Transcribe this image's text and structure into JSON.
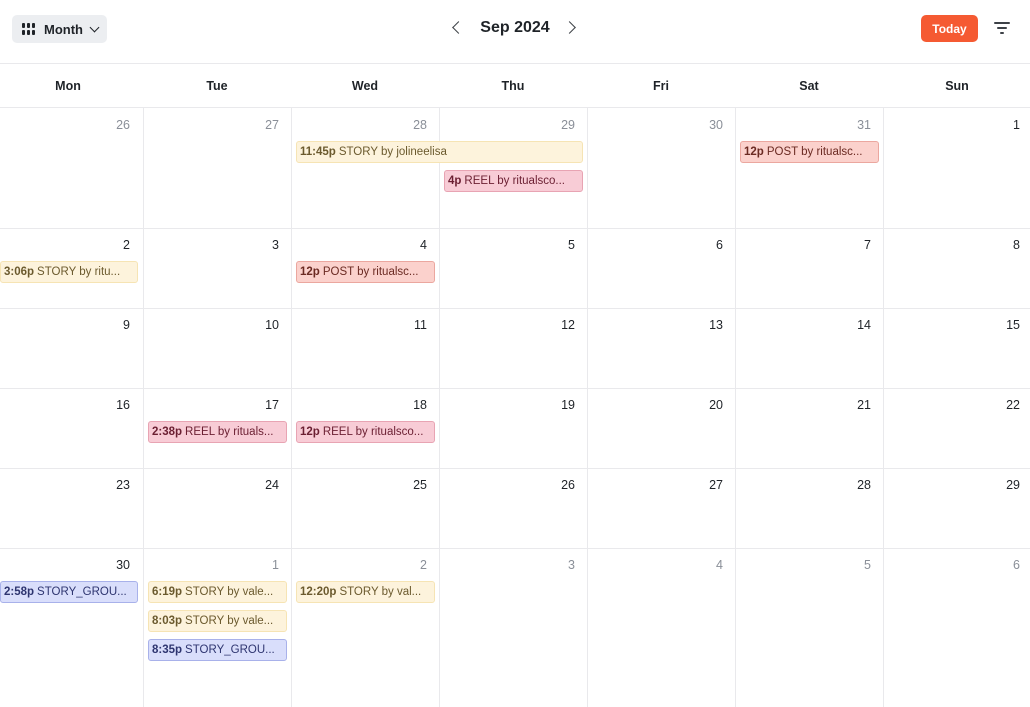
{
  "toolbar": {
    "view_label": "Month",
    "title": "Sep 2024",
    "today_label": "Today"
  },
  "weekdays": [
    "Mon",
    "Tue",
    "Wed",
    "Thu",
    "Fri",
    "Sat",
    "Sun"
  ],
  "weeks": [
    [
      {
        "n": "26",
        "out": true
      },
      {
        "n": "27",
        "out": true
      },
      {
        "n": "28",
        "out": true
      },
      {
        "n": "29",
        "out": true
      },
      {
        "n": "30",
        "out": true
      },
      {
        "n": "31",
        "out": true
      },
      {
        "n": "1",
        "out": false
      }
    ],
    [
      {
        "n": "2",
        "out": false
      },
      {
        "n": "3",
        "out": false
      },
      {
        "n": "4",
        "out": false
      },
      {
        "n": "5",
        "out": false
      },
      {
        "n": "6",
        "out": false
      },
      {
        "n": "7",
        "out": false
      },
      {
        "n": "8",
        "out": false
      }
    ],
    [
      {
        "n": "9",
        "out": false
      },
      {
        "n": "10",
        "out": false
      },
      {
        "n": "11",
        "out": false
      },
      {
        "n": "12",
        "out": false
      },
      {
        "n": "13",
        "out": false
      },
      {
        "n": "14",
        "out": false
      },
      {
        "n": "15",
        "out": false
      }
    ],
    [
      {
        "n": "16",
        "out": false
      },
      {
        "n": "17",
        "out": false
      },
      {
        "n": "18",
        "out": false
      },
      {
        "n": "19",
        "out": false
      },
      {
        "n": "20",
        "out": false
      },
      {
        "n": "21",
        "out": false
      },
      {
        "n": "22",
        "out": false
      }
    ],
    [
      {
        "n": "23",
        "out": false
      },
      {
        "n": "24",
        "out": false
      },
      {
        "n": "25",
        "out": false
      },
      {
        "n": "26",
        "out": false
      },
      {
        "n": "27",
        "out": false
      },
      {
        "n": "28",
        "out": false
      },
      {
        "n": "29",
        "out": false
      }
    ],
    [
      {
        "n": "30",
        "out": false
      },
      {
        "n": "1",
        "out": true
      },
      {
        "n": "2",
        "out": true
      },
      {
        "n": "3",
        "out": true
      },
      {
        "n": "4",
        "out": true
      },
      {
        "n": "5",
        "out": true
      },
      {
        "n": "6",
        "out": true
      }
    ]
  ],
  "events": [
    {
      "week": 0,
      "day": 2,
      "span": 2,
      "slot": 0,
      "time": "11:45p",
      "text": "STORY by jolineelisa",
      "kind": "story"
    },
    {
      "week": 0,
      "day": 3,
      "span": 1,
      "slot": 1,
      "time": "4p",
      "text": "REEL by ritualsco...",
      "kind": "reel"
    },
    {
      "week": 0,
      "day": 5,
      "span": 1,
      "slot": 0,
      "time": "12p",
      "text": "POST by ritualsc...",
      "kind": "post"
    },
    {
      "week": 1,
      "day": 0,
      "span": 1,
      "slot": 0,
      "time": "3:06p",
      "text": "STORY by ritu...",
      "kind": "story"
    },
    {
      "week": 1,
      "day": 2,
      "span": 1,
      "slot": 0,
      "time": "12p",
      "text": "POST by ritualsc...",
      "kind": "post"
    },
    {
      "week": 3,
      "day": 1,
      "span": 1,
      "slot": 0,
      "time": "2:38p",
      "text": "REEL by rituals...",
      "kind": "reel"
    },
    {
      "week": 3,
      "day": 2,
      "span": 1,
      "slot": 0,
      "time": "12p",
      "text": "REEL by ritualsco...",
      "kind": "reel"
    },
    {
      "week": 5,
      "day": 0,
      "span": 1,
      "slot": 0,
      "time": "2:58p",
      "text": "STORY_GROU...",
      "kind": "group"
    },
    {
      "week": 5,
      "day": 1,
      "span": 1,
      "slot": 0,
      "time": "6:19p",
      "text": "STORY by vale...",
      "kind": "story"
    },
    {
      "week": 5,
      "day": 1,
      "span": 1,
      "slot": 1,
      "time": "8:03p",
      "text": "STORY by vale...",
      "kind": "story"
    },
    {
      "week": 5,
      "day": 1,
      "span": 1,
      "slot": 2,
      "time": "8:35p",
      "text": "STORY_GROU...",
      "kind": "group"
    },
    {
      "week": 5,
      "day": 2,
      "span": 1,
      "slot": 0,
      "time": "12:20p",
      "text": "STORY by val...",
      "kind": "story"
    }
  ],
  "colors": {
    "accent": "#f55a32",
    "story": "#fdf3dc",
    "reel": "#f8ccd6",
    "post": "#fbd1cc",
    "story_group": "#d9defb"
  }
}
